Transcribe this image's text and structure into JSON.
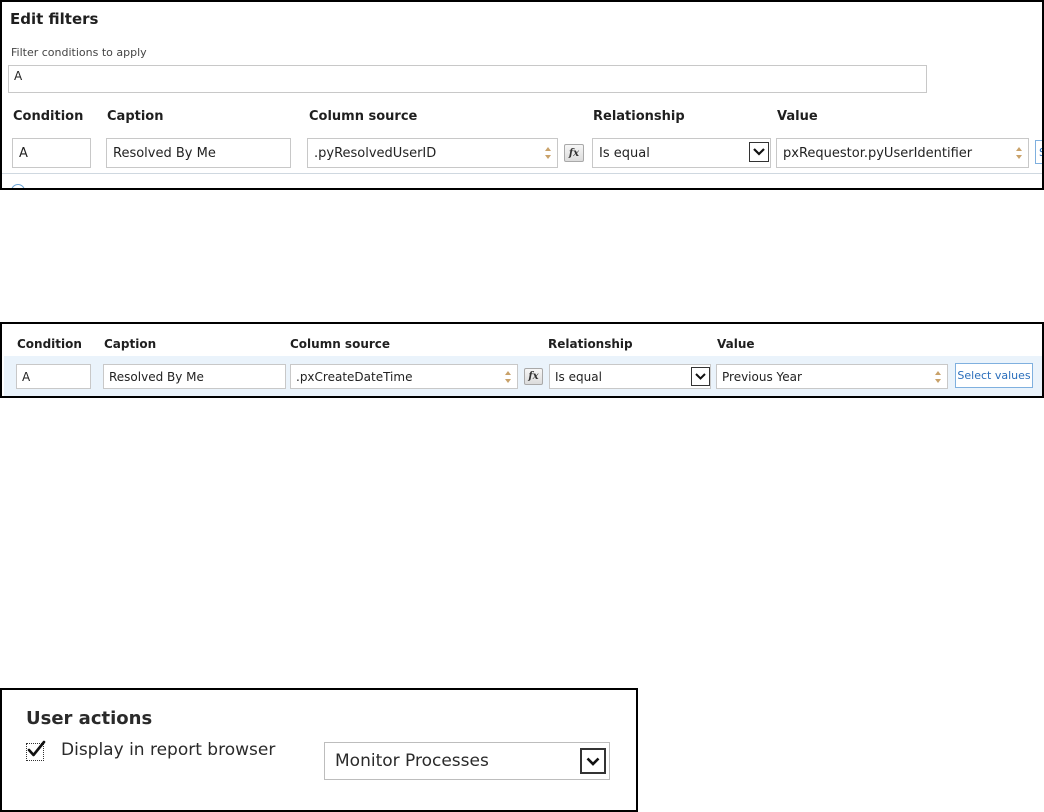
{
  "panel1": {
    "title": "Edit filters",
    "filter_label": "Filter conditions to apply",
    "filter_value": "A",
    "headers": {
      "condition": "Condition",
      "caption": "Caption",
      "column_source": "Column source",
      "relationship": "Relationship",
      "value": "Value"
    },
    "row": {
      "condition": "A",
      "caption": "Resolved By Me",
      "column_source": ".pyResolvedUserID",
      "fx": "fx",
      "relationship": "Is equal",
      "value": "pxRequestor.pyUserIdentifier"
    }
  },
  "panel2": {
    "headers": {
      "condition": "Condition",
      "caption": "Caption",
      "column_source": "Column source",
      "relationship": "Relationship",
      "value": "Value"
    },
    "row": {
      "condition": "A",
      "caption": "Resolved By Me",
      "column_source": ".pxCreateDateTime",
      "fx": "fx",
      "relationship": "Is equal",
      "value": "Previous Year",
      "select_values": "Select values"
    }
  },
  "panel3": {
    "title": "User actions",
    "checkbox_label": "Display in report browser",
    "checkbox_checked": true,
    "category_value": "Monitor Processes"
  },
  "colors": {
    "row_highlight": "#eaf3fb",
    "link_blue": "#2a6ebb",
    "spinner": "#c9a26a"
  }
}
